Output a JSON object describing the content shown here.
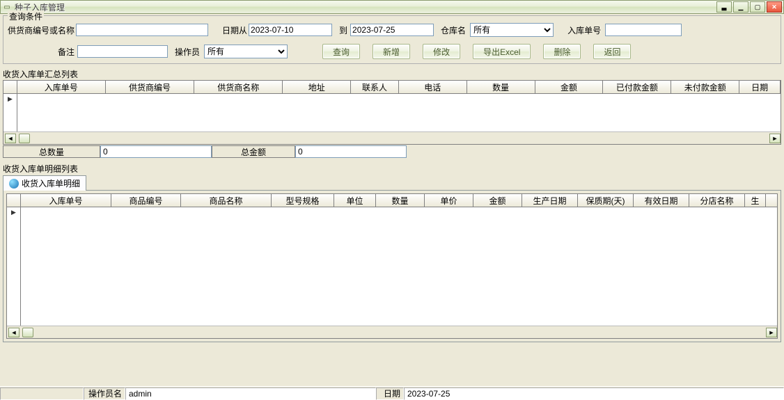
{
  "window": {
    "title": "种子入库管理"
  },
  "query": {
    "legend": "查询条件",
    "supplier_label": "供货商编号或名称",
    "supplier_value": "",
    "date_from_label": "日期从",
    "date_from_value": "2023-07-10",
    "date_to_label": "到",
    "date_to_value": "2023-07-25",
    "warehouse_label": "仓库名",
    "warehouse_value": "所有",
    "inbound_no_label": "入库单号",
    "inbound_no_value": "",
    "remark_label": "备注",
    "remark_value": "",
    "operator_label": "操作员",
    "operator_value": "所有"
  },
  "buttons": {
    "search": "查询",
    "add": "新增",
    "edit": "修改",
    "export": "导出Excel",
    "delete": "删除",
    "back": "返回"
  },
  "summary_title": "收货入库单汇总列表",
  "summary_cols": [
    "入库单号",
    "供货商编号",
    "供货商名称",
    "地址",
    "联系人",
    "电话",
    "数量",
    "金额",
    "已付款金额",
    "未付款金额",
    "日期"
  ],
  "totals": {
    "qty_label": "总数量",
    "qty_value": "0",
    "amt_label": "总金额",
    "amt_value": "0"
  },
  "detail_title": "收货入库单明细列表",
  "detail_tab": "收货入库单明细",
  "detail_cols": [
    "入库单号",
    "商品编号",
    "商品名称",
    "型号规格",
    "单位",
    "数量",
    "单价",
    "金额",
    "生产日期",
    "保质期(天)",
    "有效日期",
    "分店名称",
    "生"
  ],
  "status": {
    "operator_label": "操作员名",
    "operator_value": "admin",
    "date_label": "日期",
    "date_value": "2023-07-25"
  }
}
